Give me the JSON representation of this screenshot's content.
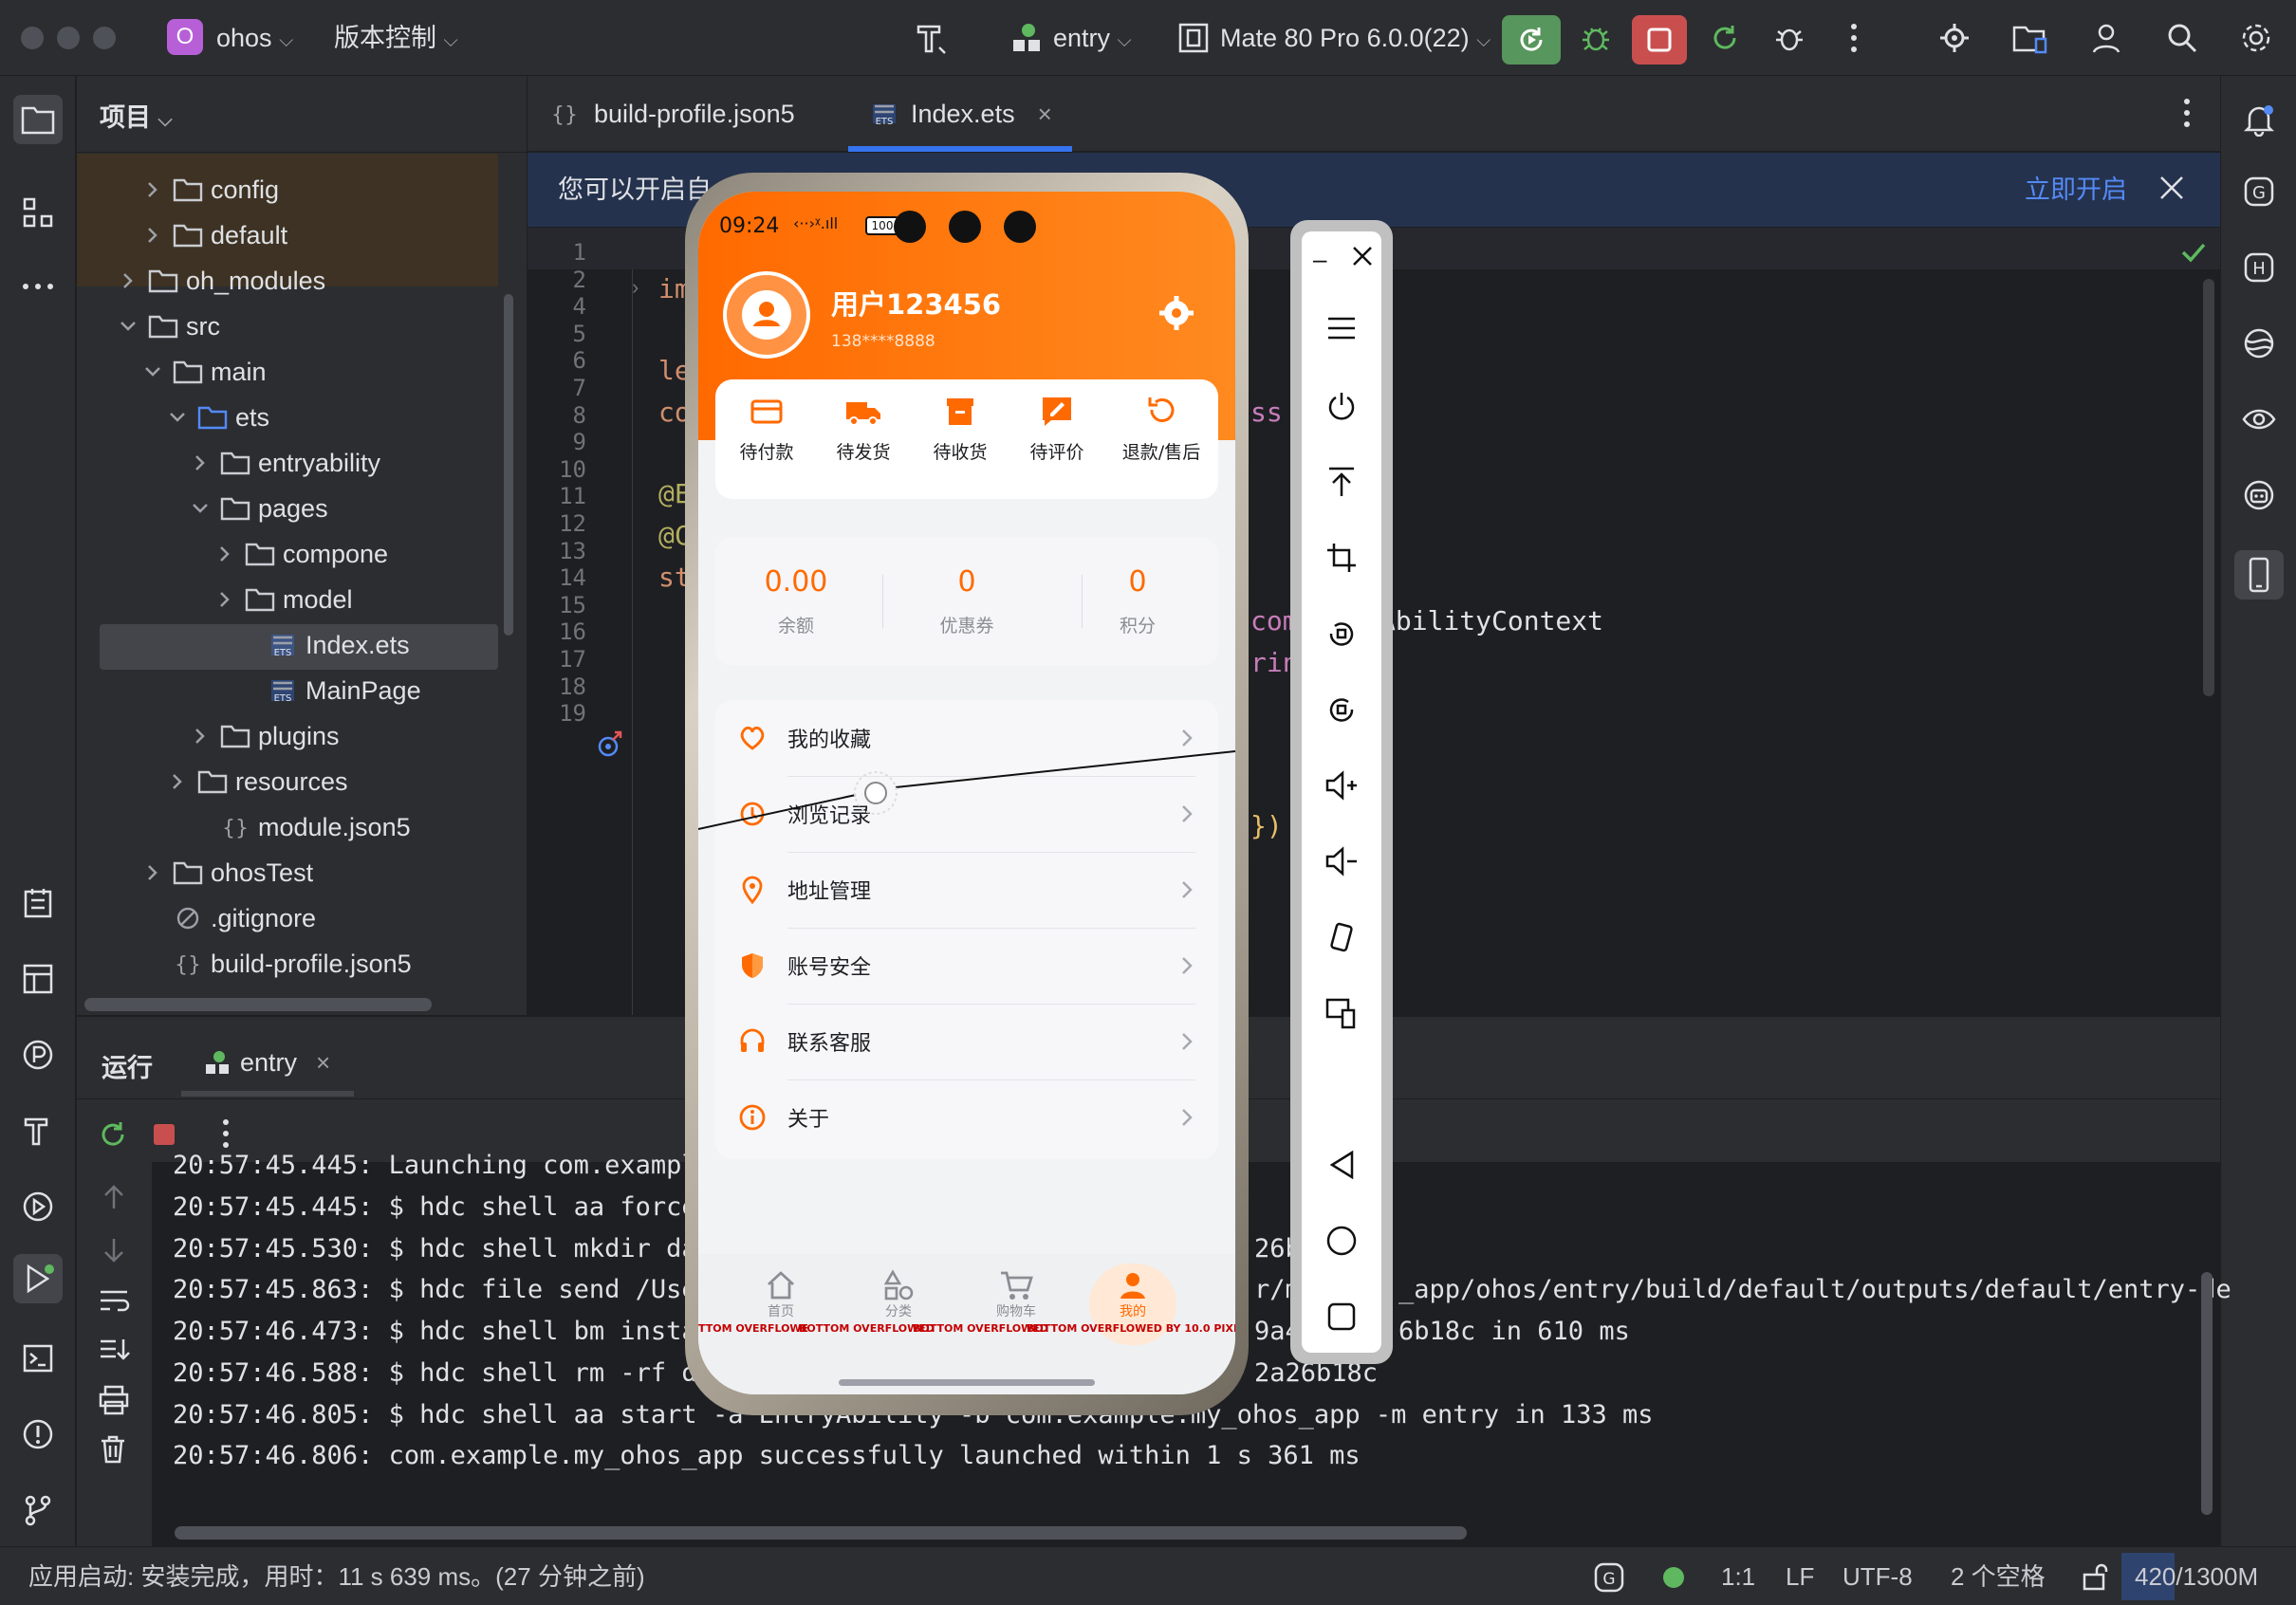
{
  "titlebar": {
    "project_badge": "O",
    "project_name": "ohos",
    "vcs_label": "版本控制",
    "run_config": "entry",
    "device": "Mate 80 Pro 6.0.0(22)"
  },
  "project_panel": {
    "title": "项目",
    "tree": [
      {
        "label": "config",
        "type": "folder",
        "expanded": false
      },
      {
        "label": "default",
        "type": "folder",
        "expanded": false
      },
      {
        "label": "oh_modules",
        "type": "folder",
        "expanded": false
      },
      {
        "label": "src",
        "type": "folder",
        "expanded": true
      },
      {
        "label": "main",
        "type": "folder",
        "expanded": true
      },
      {
        "label": "ets",
        "type": "folder",
        "expanded": true
      },
      {
        "label": "entryability",
        "type": "folder",
        "expanded": false
      },
      {
        "label": "pages",
        "type": "folder",
        "expanded": true
      },
      {
        "label": "compone",
        "type": "folder",
        "expanded": false
      },
      {
        "label": "model",
        "type": "folder",
        "expanded": false
      },
      {
        "label": "Index.ets",
        "type": "file-ets",
        "selected": true
      },
      {
        "label": "MainPage",
        "type": "file-ets"
      },
      {
        "label": "plugins",
        "type": "folder",
        "expanded": false
      },
      {
        "label": "resources",
        "type": "folder",
        "expanded": false
      },
      {
        "label": "module.json5",
        "type": "file-json"
      },
      {
        "label": "ohosTest",
        "type": "folder",
        "expanded": false
      },
      {
        "label": ".gitignore",
        "type": "file-ignore"
      },
      {
        "label": "build-profile.json5",
        "type": "file-json"
      }
    ]
  },
  "editor": {
    "tabs": [
      {
        "label": "build-profile.json5",
        "active": false
      },
      {
        "label": "Index.ets",
        "active": true
      }
    ],
    "banner_text": "您可以开启自",
    "banner_action": "立即开启",
    "line_numbers": [
      "1",
      "2",
      "4",
      "5",
      "6",
      "7",
      "8",
      "9",
      "10",
      "11",
      "12",
      "13",
      "14",
      "15",
      "16",
      "17",
      "18",
      "19"
    ],
    "code_fragments": {
      "l2": "im",
      "l5": "le",
      "l6": "co",
      "l6_right": "ss",
      "l8": "@E",
      "l9": "@C",
      "l10": "st",
      "l11_right_a": "com",
      "l11_right_b": "AbilityContext",
      "l12_right": "rin",
      "l16_right": "})"
    }
  },
  "run_panel": {
    "title": "运行",
    "config_tab": "entry",
    "console_lines": [
      "20:57:45.445: Launching com.example",
      "20:57:45.445: $ hdc shell aa force-",
      "20:57:45.530: $ hdc shell mkdir dat",
      "20:57:45.863: $ hdc file send /User",
      "20:57:46.473: $ hdc shell bm instal",
      "20:57:46.588: $ hdc shell rm -rf da",
      "20:57:46.805: $ hdc shell aa start -a EntryAbility -b com.example.my_ohos_app -m entry in 133 ms",
      "20:57:46.806: com.example.my_ohos_app successfully launched within 1 s 361 ms"
    ],
    "console_right_fragments": [
      {
        "row": 2,
        "text": "26b"
      },
      {
        "row": 3,
        "text": "r/m"
      },
      {
        "row": 3,
        "text2": "_app/ohos/entry/build/default/outputs/default/entry-de"
      },
      {
        "row": 4,
        "text": "9a4"
      },
      {
        "row": 4,
        "text2": "6b18c in 610 ms"
      },
      {
        "row": 5,
        "text": "2a26b18c"
      }
    ]
  },
  "statusbar": {
    "message": "应用启动: 安装完成，用时：11 s 639 ms。(27 分钟之前)",
    "position": "1:1",
    "line_sep": "LF",
    "encoding": "UTF-8",
    "indent": "2 个空格",
    "memory": "420/1300M",
    "memory_used_fraction": 0.323
  },
  "phone": {
    "time": "09:24",
    "battery": "100",
    "user_name": "用户123456",
    "phone_masked": "138****8888",
    "orders": [
      "待付款",
      "待发货",
      "待收货",
      "待评价",
      "退款/售后"
    ],
    "stats": [
      {
        "value": "0.00",
        "label": "余额"
      },
      {
        "value": "0",
        "label": "优惠券"
      },
      {
        "value": "0",
        "label": "积分"
      }
    ],
    "menu": [
      "我的收藏",
      "浏览记录",
      "地址管理",
      "账号安全",
      "联系客服",
      "关于"
    ],
    "tabbar": [
      "首页",
      "分类",
      "购物车",
      "我的"
    ],
    "overflow_labels": [
      "TTOM OVERFLOWE",
      "BOTTOM OVERFLOWED",
      "BOTTOM OVERFLOWED",
      "BOTTOM OVERFLOWED BY 10.0 PIXE"
    ],
    "accent": "#ff6a00"
  },
  "colors": {
    "ide_bg": "#1e1f22",
    "panel_bg": "#2b2d30",
    "run_green": "#57965c",
    "stop_red": "#c94f4f",
    "link_blue": "#548af7"
  }
}
